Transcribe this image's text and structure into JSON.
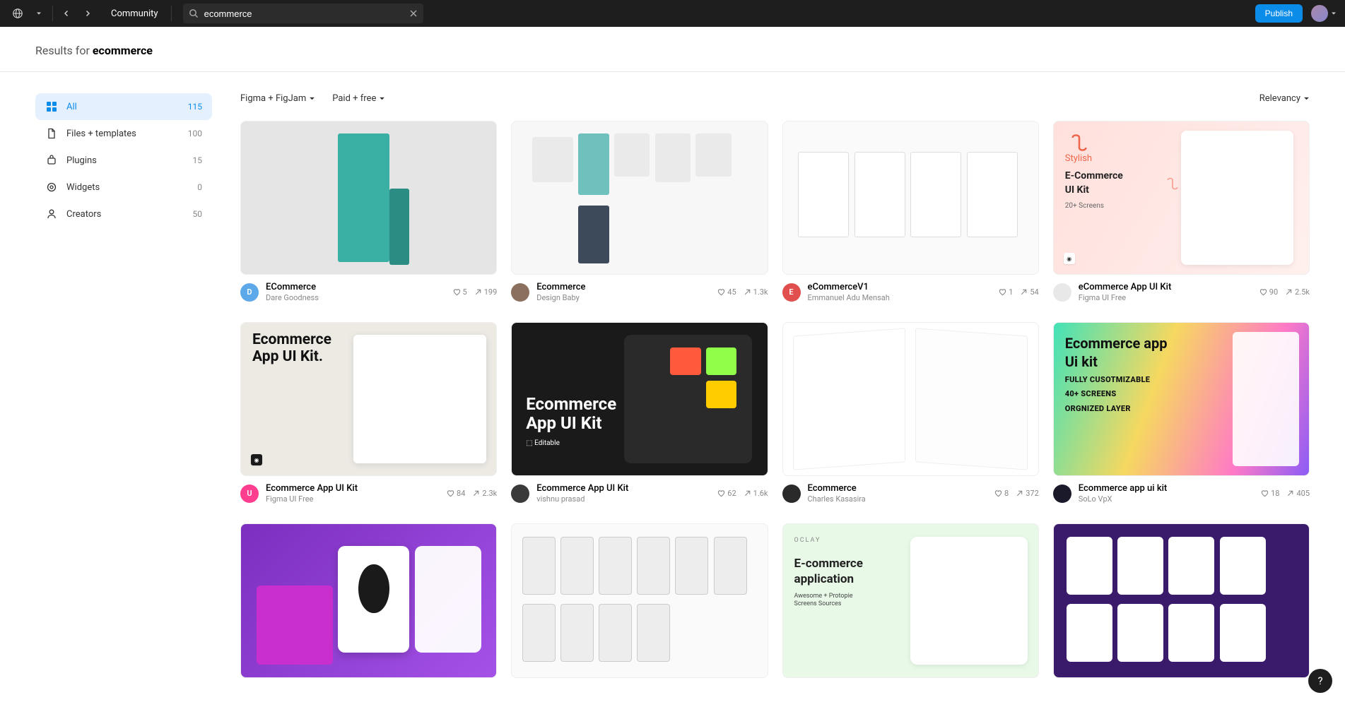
{
  "topbar": {
    "community_label": "Community",
    "search_value": "ecommerce",
    "publish_label": "Publish"
  },
  "header": {
    "prefix": "Results for ",
    "query": "ecommerce"
  },
  "sidebar": {
    "items": [
      {
        "label": "All",
        "count": "115"
      },
      {
        "label": "Files + templates",
        "count": "100"
      },
      {
        "label": "Plugins",
        "count": "15"
      },
      {
        "label": "Widgets",
        "count": "0"
      },
      {
        "label": "Creators",
        "count": "50"
      }
    ]
  },
  "filters": {
    "product": "Figma + FigJam",
    "price": "Paid + free",
    "sort": "Relevancy"
  },
  "cards": [
    {
      "title": "ECommerce",
      "author": "Dare Goodness",
      "likes": "5",
      "uses": "199",
      "avatar_bg": "#5ca8e8",
      "avatar_letter": "D",
      "thumb_class": "bg-1"
    },
    {
      "title": "Ecommerce",
      "author": "Design Baby",
      "likes": "45",
      "uses": "1.3k",
      "avatar_bg": "#8b6f5f",
      "avatar_letter": "",
      "thumb_class": "bg-2"
    },
    {
      "title": "eCommerceV1",
      "author": "Emmanuel Adu Mensah",
      "likes": "1",
      "uses": "54",
      "avatar_bg": "#e04e4e",
      "avatar_letter": "E",
      "thumb_class": "bg-3"
    },
    {
      "title": "eCommerce App UI Kit",
      "author": "Figma UI Free",
      "likes": "90",
      "uses": "2.5k",
      "avatar_bg": "#e8e8e8",
      "avatar_letter": "",
      "thumb_class": "bg-4"
    },
    {
      "title": "Ecommerce App UI Kit",
      "author": "Figma UI Free",
      "likes": "84",
      "uses": "2.3k",
      "avatar_bg": "#ff3e8f",
      "avatar_letter": "U",
      "thumb_class": "bg-5"
    },
    {
      "title": "Ecommerce App UI Kit",
      "author": "vishnu prasad",
      "likes": "62",
      "uses": "1.6k",
      "avatar_bg": "#3a3a3a",
      "avatar_letter": "",
      "thumb_class": "bg-6"
    },
    {
      "title": "Ecommerce",
      "author": "Charles Kasasira",
      "likes": "8",
      "uses": "372",
      "avatar_bg": "#2a2a2a",
      "avatar_letter": "",
      "thumb_class": "bg-7"
    },
    {
      "title": "Ecommerce app ui kit",
      "author": "SoLo VpX",
      "likes": "18",
      "uses": "405",
      "avatar_bg": "#1a1a2a",
      "avatar_letter": "",
      "thumb_class": "bg-8"
    },
    {
      "title": "",
      "author": "",
      "likes": "",
      "uses": "",
      "avatar_bg": "",
      "avatar_letter": "",
      "thumb_class": "bg-9"
    },
    {
      "title": "",
      "author": "",
      "likes": "",
      "uses": "",
      "avatar_bg": "",
      "avatar_letter": "",
      "thumb_class": "bg-10"
    },
    {
      "title": "",
      "author": "",
      "likes": "",
      "uses": "",
      "avatar_bg": "",
      "avatar_letter": "",
      "thumb_class": "bg-11"
    },
    {
      "title": "",
      "author": "",
      "likes": "",
      "uses": "",
      "avatar_bg": "",
      "avatar_letter": "",
      "thumb_class": "bg-12"
    }
  ],
  "thumb_text": {
    "t4_stylish": "Stylish",
    "t4_main": "E-Commerce\nUI Kit",
    "t4_sub": "20+ Screens",
    "t5": "Ecommerce\nApp UI Kit.",
    "t6": "Ecommerce\nApp UI Kit",
    "t6_ed": "⬚ Editable",
    "t8": "Ecommerce app\nUi kit",
    "t8_s1": "FULLY CUSOTMIZABLE",
    "t8_s2": "40+ SCREENS",
    "t8_s3": "ORGNIZED LAYER",
    "t11": "E-commerce\napplication",
    "t11_sub": "Awesome      + Protopie\nScreens         Sources",
    "t11_brand": "OCLAY"
  }
}
